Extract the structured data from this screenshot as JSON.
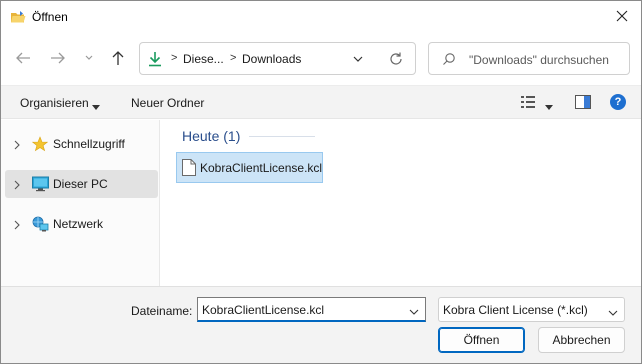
{
  "window": {
    "title": "Öffnen"
  },
  "navigation": {
    "back_icon": "arrow-left-icon",
    "forward_icon": "arrow-right-icon",
    "recent_icon": "chevron-down-icon",
    "up_icon": "arrow-up-icon"
  },
  "address": {
    "icon": "download-icon",
    "parts": [
      "Diese...",
      "Downloads"
    ],
    "separator": ">"
  },
  "search": {
    "placeholder": "\"Downloads\" durchsuchen"
  },
  "toolbar": {
    "organize_label": "Organisieren",
    "new_folder_label": "Neuer Ordner",
    "help_label": "?"
  },
  "sidebar": {
    "items": [
      {
        "label": "Schnellzugriff",
        "icon": "star-icon",
        "selected": false
      },
      {
        "label": "Dieser PC",
        "icon": "monitor-icon",
        "selected": true
      },
      {
        "label": "Netzwerk",
        "icon": "network-icon",
        "selected": false
      }
    ]
  },
  "content": {
    "group_header": "Heute (1)",
    "files": [
      {
        "name": "KobraClientLicense.kcl",
        "icon": "file-icon",
        "selected": true
      }
    ]
  },
  "footer": {
    "filename_label": "Dateiname:",
    "filename_value": "KobraClientLicense.kcl",
    "filter_value": "Kobra Client License (*.kcl)",
    "open_button": "Öffnen",
    "cancel_button": "Abbrechen"
  },
  "colors": {
    "accent": "#0067c0",
    "selection_bg": "#cce4f7",
    "group_header": "#2a4e8c",
    "download_arrow": "#1a9b5e"
  }
}
